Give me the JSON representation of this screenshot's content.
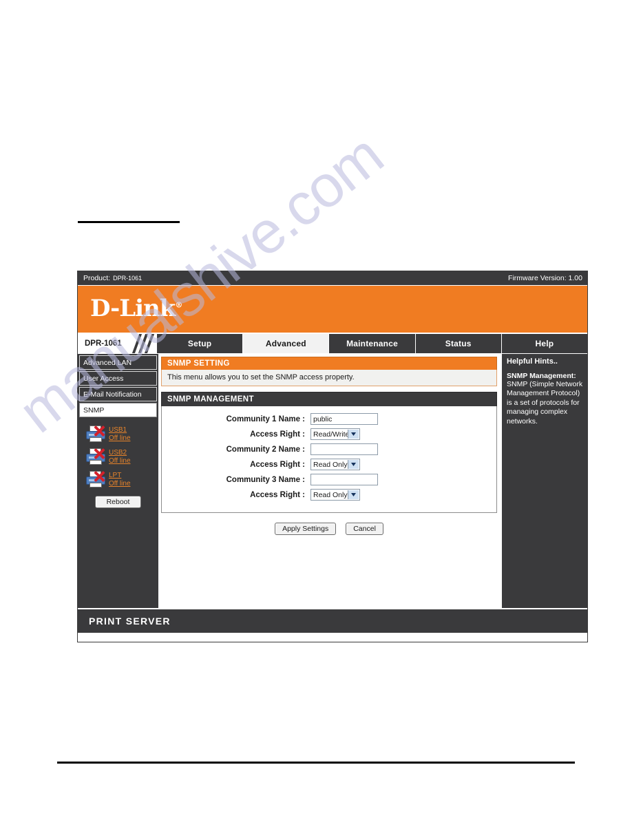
{
  "watermark": {
    "text": "manualshive.com"
  },
  "device": {
    "product_bar": {
      "product_label": "Product:",
      "product_value": "DPR-1061",
      "firmware": "Firmware Version: 1.00"
    },
    "brand": {
      "name": "D-Link",
      "registered": "®"
    },
    "nav": {
      "model_tab": "DPR-1061",
      "tabs": [
        {
          "label": "Setup",
          "active": false
        },
        {
          "label": "Advanced",
          "active": true
        },
        {
          "label": "Maintenance",
          "active": false
        },
        {
          "label": "Status",
          "active": false
        },
        {
          "label": "Help",
          "active": false
        }
      ]
    },
    "sidebar": {
      "items": [
        {
          "label": "Advanced LAN",
          "selected": false
        },
        {
          "label": "User Access",
          "selected": false
        },
        {
          "label": "E-Mail Notification",
          "selected": false
        },
        {
          "label": "SNMP",
          "selected": true
        }
      ],
      "printers": [
        {
          "port": "USB1",
          "status": "Off line"
        },
        {
          "port": "USB2",
          "status": "Off line"
        },
        {
          "port": "LPT",
          "status": "Off line"
        }
      ],
      "reboot_label": "Reboot"
    },
    "main": {
      "section_title": "SNMP SETTING",
      "section_description": "This menu allows you to set the SNMP access property.",
      "panel_title": "SNMP MANAGEMENT",
      "fields": [
        {
          "label": "Community 1 Name  :",
          "type": "text",
          "value": "public",
          "placeholder": ""
        },
        {
          "label": "Access Right  :",
          "type": "select",
          "value": "Read/Write"
        },
        {
          "label": "Community 2 Name  :",
          "type": "text",
          "value": "",
          "placeholder": ""
        },
        {
          "label": "Access Right  :",
          "type": "select",
          "value": "Read Only"
        },
        {
          "label": "Community 3 Name  :",
          "type": "text",
          "value": "",
          "placeholder": ""
        },
        {
          "label": "Access Right  :",
          "type": "select",
          "value": "Read Only"
        }
      ],
      "apply_label": "Apply Settings",
      "cancel_label": "Cancel"
    },
    "hints": {
      "title": "Helpful Hints..",
      "subtitle": "SNMP Management:",
      "text": "SNMP (Simple Network Management Protocol) is a set of protocols for managing complex networks."
    },
    "footer": {
      "text": "PRINT SERVER"
    }
  },
  "colors": {
    "orange": "#f07c22",
    "dark": "#3a3a3c",
    "link_orange": "#e8842a",
    "watermark": "#b9bade"
  }
}
